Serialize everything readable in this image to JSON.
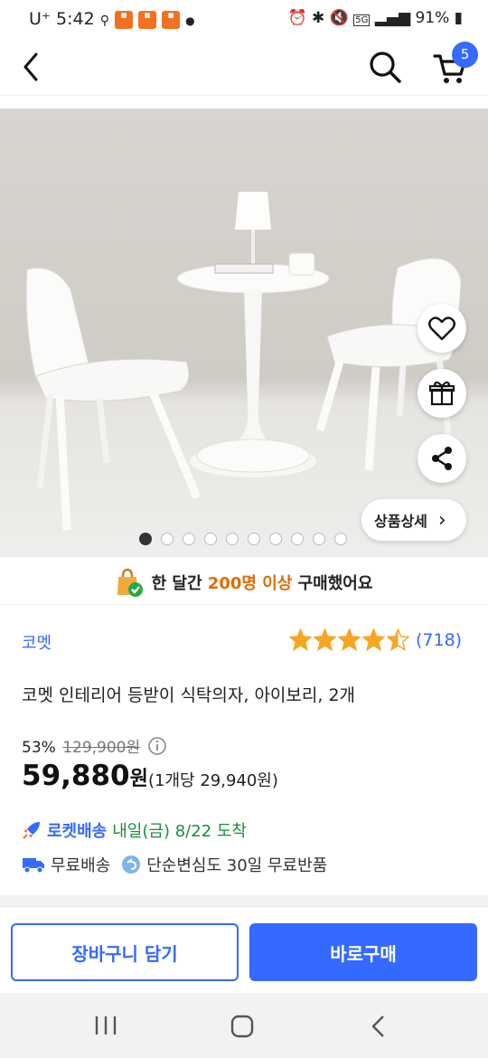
{
  "status_bar": {
    "carrier": "U⁺",
    "time": "5:42",
    "network": "5G",
    "battery": "91%",
    "icons": [
      "alarm-icon",
      "bluetooth-icon",
      "mute-icon",
      "signal-icon",
      "battery-icon"
    ]
  },
  "nav": {
    "cart_count": "5"
  },
  "gallery": {
    "image_count": 10,
    "active_index": 0,
    "detail_label": "상품상세",
    "detail_arrow": "›"
  },
  "banner": {
    "prefix": "한 달간 ",
    "highlight": "200명 이상",
    "suffix": " 구매했어요"
  },
  "product": {
    "brand": "코멧",
    "rating": 4.5,
    "review_count": "(718)",
    "title": "코멧 인테리어 등받이 식탁의자, 아이보리, 2개",
    "discount": "53%",
    "original_price": "129,900원",
    "price": "59,880",
    "price_unit": "원",
    "unit_price": "(1개당 29,940원)"
  },
  "delivery": {
    "rocket_label": "로켓배송",
    "rocket_date": "내일(금) 8/22 도착",
    "free_shipping": "무료배송",
    "free_return": "단순변심도 30일 무료반품"
  },
  "actions": {
    "cart": "장바구니 담기",
    "buy": "바로구매"
  },
  "colors": {
    "accent": "#346aff",
    "highlight": "#e06d00",
    "delivery_green": "#1a8c3f",
    "star": "#f5a623"
  }
}
